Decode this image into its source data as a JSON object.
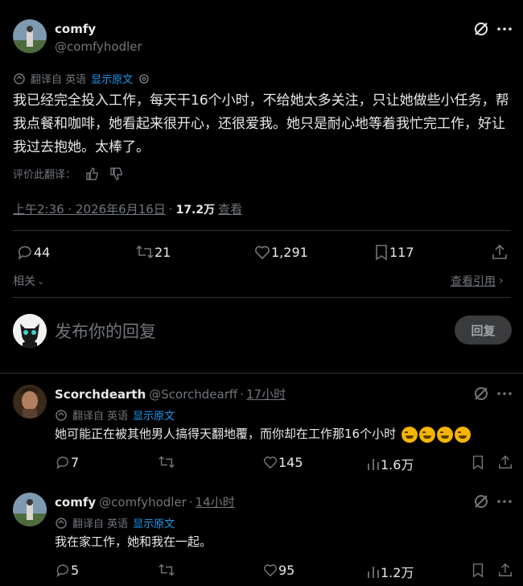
{
  "main_post": {
    "display_name": "comfy",
    "handle": "@comfyhodler",
    "translated_from": "翻译自 英语",
    "show_original": "显示原文",
    "text": "我已经完全投入工作，每天干16个小时，不给她太多关注，只让她做些小任务，帮我点餐和咖啡，她看起来很开心，还很爱我。她只是耐心地等着我忙完工作，好让我过去抱她。太棒了。",
    "rate_translation": "评价此翻译：",
    "timestamp": "上午2:36 · 2026年6月16日",
    "views_count": "17.2万",
    "views_label": "查看",
    "replies": "44",
    "retweets": "21",
    "likes": "1,291",
    "bookmarks": "117",
    "related": "相关",
    "view_quotes": "查看引用"
  },
  "composer": {
    "placeholder": "发布你的回复",
    "reply_button": "回复"
  },
  "replies": [
    {
      "display_name": "Scorchdearth",
      "handle": "@Scorchdearff",
      "time": "17小时",
      "translated_from": "翻译自 英语",
      "show_original": "显示原文",
      "text": "她可能正在被其他男人搞得天翻地覆，而你却在工作那16个小时",
      "replies": "7",
      "retweets": "",
      "likes": "145",
      "views": "1.6万"
    },
    {
      "display_name": "comfy",
      "handle": "@comfyhodler",
      "time": "14小时",
      "translated_from": "翻译自 英语",
      "show_original": "显示原文",
      "text": "我在家工作，她和我在一起。",
      "replies": "5",
      "retweets": "",
      "likes": "95",
      "views": "1.2万"
    }
  ],
  "colors": {
    "background": "#000000",
    "text": "#e7e9ea",
    "muted": "#71767b",
    "link": "#1d9bf0",
    "border": "#2f3336"
  }
}
